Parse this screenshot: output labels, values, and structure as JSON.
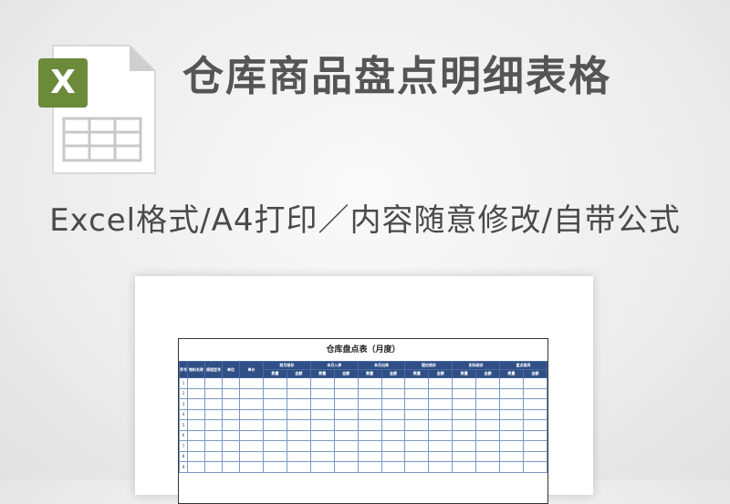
{
  "icon": {
    "name": "excel-file-icon",
    "badge_letter": "X",
    "accent": "#6b8a3a"
  },
  "title": "仓库商品盘点明细表格",
  "subtitle": "Excel格式/A4打印／内容随意修改/自带公式",
  "sheet": {
    "title": "仓库盘点表（月度）",
    "fixed_headers": [
      "序号",
      "物料名称",
      "规格型号",
      "单位",
      "单价"
    ],
    "group_headers": [
      "前月结存",
      "本月入库",
      "本月出库",
      "理论结存",
      "实际结存",
      "盘点差异"
    ],
    "sub_headers": [
      "数量",
      "金额"
    ],
    "row_numbers": [
      "1",
      "2",
      "3",
      "4",
      "5",
      "6",
      "7",
      "8",
      "9"
    ]
  }
}
